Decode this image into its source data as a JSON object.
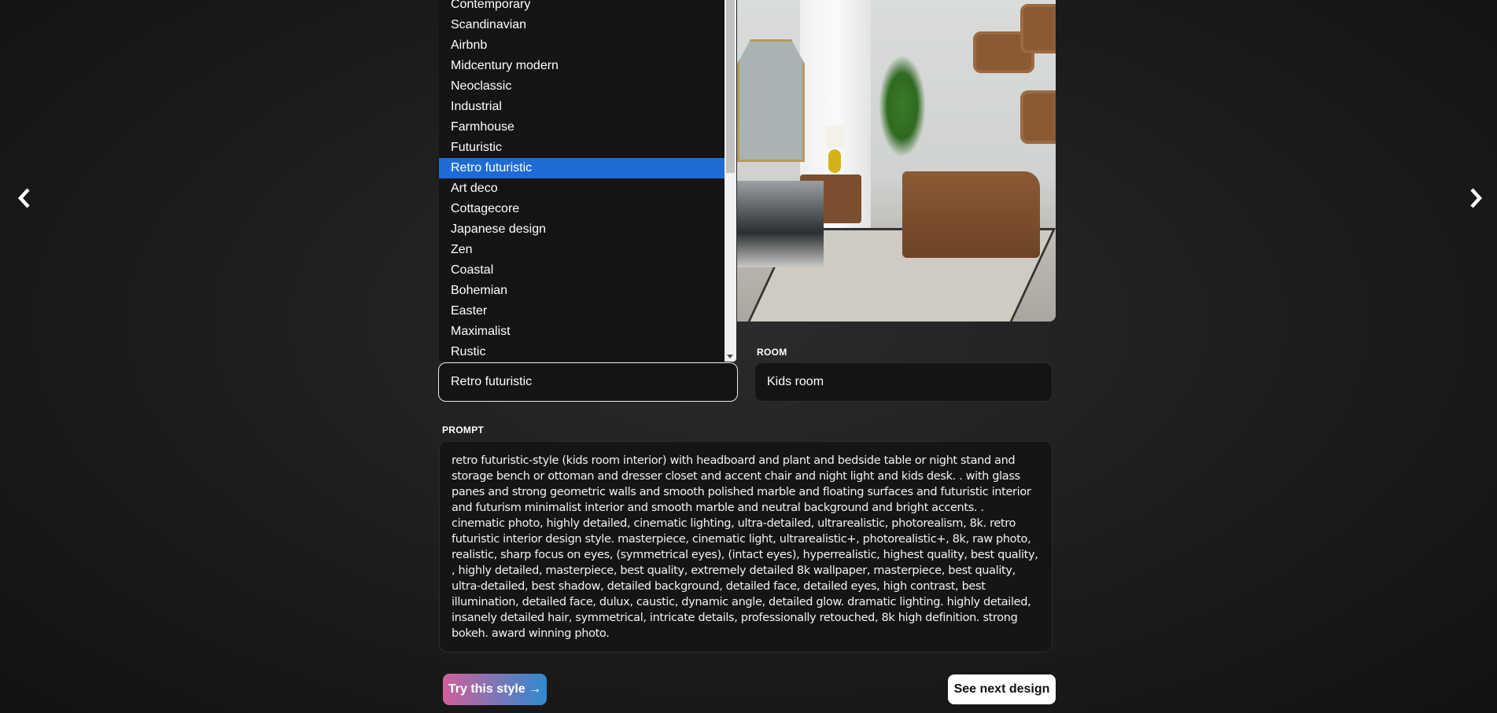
{
  "navigation": {
    "prev_icon": "chevron-left-icon",
    "next_icon": "chevron-right-icon"
  },
  "preview": {
    "image": "retro futuristic kids room interior photo"
  },
  "style_dropdown": {
    "options": [
      "Contemporary",
      "Scandinavian",
      "Airbnb",
      "Midcentury modern",
      "Neoclassic",
      "Industrial",
      "Farmhouse",
      "Futuristic",
      "Retro futuristic",
      "Art deco",
      "Cottagecore",
      "Japanese design",
      "Zen",
      "Coastal",
      "Bohemian",
      "Easter",
      "Maximalist",
      "Rustic"
    ],
    "highlighted": "Retro futuristic",
    "selected_value": "Retro futuristic"
  },
  "room": {
    "label": "ROOM",
    "value": "Kids room"
  },
  "prompt": {
    "label": "PROMPT",
    "value": "retro futuristic-style (kids room interior) with headboard and plant and bedside table or night stand and storage bench or ottoman and dresser closet and accent chair and night light and kids desk. . with glass panes and strong geometric walls and smooth polished marble and floating surfaces and futuristic interior and futurism minimalist interior and smooth marble and neutral background and bright accents. . cinematic photo, highly detailed, cinematic lighting, ultra-detailed, ultrarealistic, photorealism, 8k. retro futuristic interior design style. masterpiece, cinematic light, ultrarealistic+, photorealistic+, 8k, raw photo, realistic, sharp focus on eyes, (symmetrical eyes), (intact eyes), hyperrealistic, highest quality, best quality, , highly detailed, masterpiece, best quality, extremely detailed 8k wallpaper, masterpiece, best quality, ultra-detailed, best shadow, detailed background, detailed face, detailed eyes, high contrast, best illumination, detailed face, dulux, caustic, dynamic angle, detailed glow. dramatic lighting. highly detailed, insanely detailed hair, symmetrical, intricate details, professionally retouched, 8k high definition. strong bokeh. award winning photo."
  },
  "actions": {
    "try_label": "Try this style →",
    "next_label": "See next design"
  },
  "colors": {
    "highlight": "#1f6bd6",
    "try_gradient_start": "#d0609a",
    "try_gradient_end": "#2f8ad0"
  }
}
